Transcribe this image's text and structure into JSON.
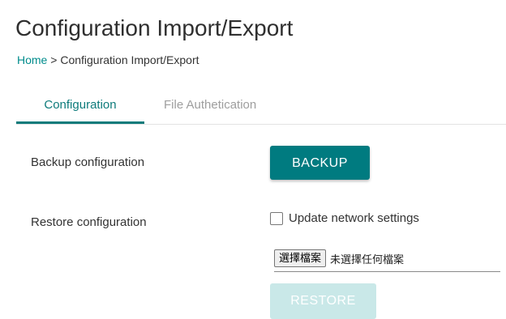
{
  "header": {
    "title": "Configuration Import/Export"
  },
  "breadcrumb": {
    "home": "Home",
    "separator": ">",
    "current": "Configuration Import/Export"
  },
  "tabs": [
    {
      "label": "Configuration",
      "active": true
    },
    {
      "label": "File Authetication",
      "active": false
    }
  ],
  "backup": {
    "label": "Backup configuration",
    "button_label": "BACKUP"
  },
  "restore": {
    "label": "Restore configuration",
    "checkbox_label": "Update network settings",
    "checkbox_checked": false,
    "file_button_label": "選擇檔案",
    "file_status": "未選擇任何檔案",
    "button_label": "RESTORE",
    "button_disabled": true
  },
  "colors": {
    "accent": "#007b80",
    "link": "#008c8c",
    "disabled_button": "#c9e8e8"
  }
}
